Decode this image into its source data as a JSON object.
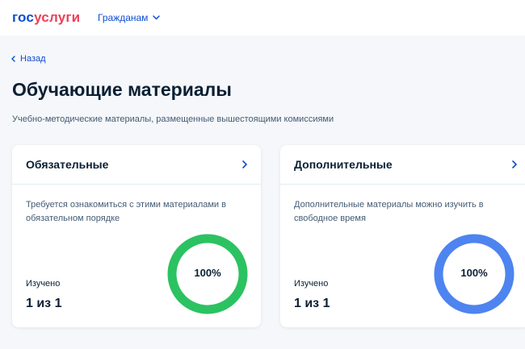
{
  "header": {
    "logo_part1": "гос",
    "logo_part2": "услуги",
    "nav_dropdown": "Гражданам",
    "logo_colors": {
      "blue": "#0d4cd3",
      "red": "#ee3f58"
    }
  },
  "back_link": "Назад",
  "page_title": "Обучающие материалы",
  "subtitle": "Учебно-методические материалы, размещенные вышестоящими комиссиями",
  "cards": [
    {
      "title": "Обязательные",
      "description": "Требуется ознакомиться с этими материалами в обязательном порядке",
      "studied_label": "Изучено",
      "studied_value": "1 из 1",
      "progress_label": "100%",
      "progress": 1.0,
      "ring_color": "#2bc261",
      "icon": "chevron-right-icon"
    },
    {
      "title": "Дополнительные",
      "description": "Дополнительные материалы можно изучить в свободное время",
      "studied_label": "Изучено",
      "studied_value": "1 из 1",
      "progress_label": "100%",
      "progress": 1.0,
      "ring_color": "#4d84f0",
      "icon": "chevron-right-icon"
    }
  ]
}
